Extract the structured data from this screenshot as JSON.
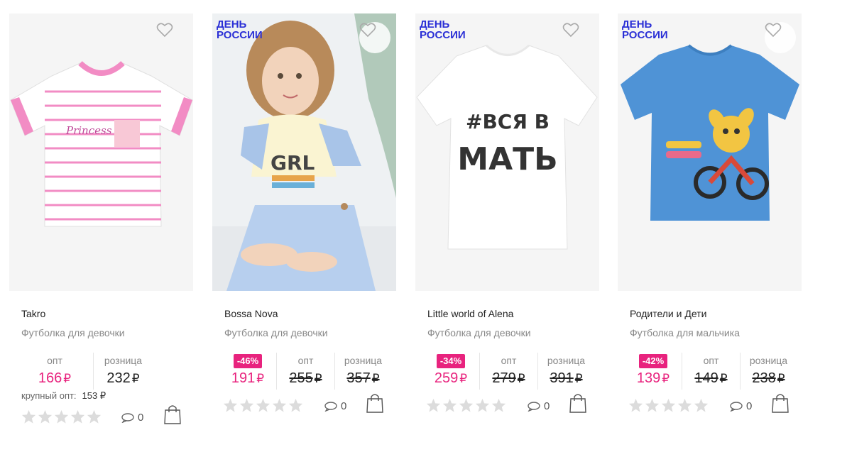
{
  "currency_symbol": "₽",
  "colors": {
    "accent_pink": "#e8237e",
    "promo_blue": "#2a2fd6",
    "star_gray": "#dcdcdc"
  },
  "icons": {
    "favorite": "heart-outline-icon",
    "comments": "comment-bubble-icon",
    "cart": "shopping-bag-icon",
    "rating": "star-icon"
  },
  "products": [
    {
      "promo": "",
      "brand": "Takro",
      "title": "Футболка для девочки",
      "discount": "",
      "opt_label": "опт",
      "opt_price": "166",
      "retail_label": "розница",
      "retail_price": "232",
      "bulk_label": "крупный опт:",
      "bulk_price": "153 ₽",
      "comments": "0",
      "rating": 0,
      "image": "pink-striped-princess-tshirt"
    },
    {
      "promo": "ДЕНЬ РОССИИ",
      "brand": "Bossa Nova",
      "title": "Футболка для девочки",
      "discount": "-46%",
      "sale_price": "191",
      "opt_label": "опт",
      "opt_price": "255",
      "retail_label": "розница",
      "retail_price": "357",
      "comments": "0",
      "rating": 0,
      "image": "girl-in-blue-overalls"
    },
    {
      "promo": "ДЕНЬ РОССИИ",
      "brand": "Little world of Alena",
      "title": "Футболка для девочки",
      "discount": "-34%",
      "sale_price": "259",
      "opt_label": "опт",
      "opt_price": "279",
      "retail_label": "розница",
      "retail_price": "391",
      "print_line1": "#ВСЯ В",
      "print_line2": "МАТЬ",
      "comments": "0",
      "rating": 0,
      "image": "white-tshirt-print"
    },
    {
      "promo": "ДЕНЬ РОССИИ",
      "brand": "Родители и Дети",
      "title": "Футболка для мальчика",
      "discount": "-42%",
      "sale_price": "139",
      "opt_label": "опт",
      "opt_price": "149",
      "retail_label": "розница",
      "retail_price": "238",
      "comments": "0",
      "rating": 0,
      "image": "blue-tshirt-dog-motorbike"
    }
  ]
}
